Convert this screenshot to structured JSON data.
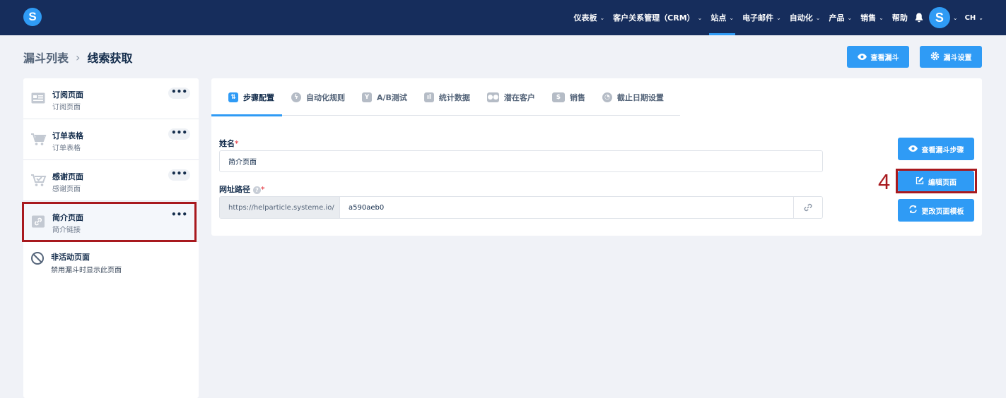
{
  "nav": {
    "items": [
      {
        "label": "仪表板"
      },
      {
        "label": "客户关系管理（CRM）"
      },
      {
        "label": "站点"
      },
      {
        "label": "电子邮件"
      },
      {
        "label": "自动化"
      },
      {
        "label": "产品"
      },
      {
        "label": "销售"
      },
      {
        "label": "帮助"
      }
    ],
    "active_item": "站点",
    "avatar_letter": "S",
    "language": "CH",
    "logo_letter": "S"
  },
  "breadcrumb": {
    "parent": "漏斗列表",
    "current": "线索获取"
  },
  "header_buttons": {
    "view_funnel": "查看漏斗",
    "funnel_settings": "漏斗设置"
  },
  "sidebar": {
    "steps": [
      {
        "title": "订阅页面",
        "subtitle": "订阅页面",
        "icon": "form-icon"
      },
      {
        "title": "订单表格",
        "subtitle": "订单表格",
        "icon": "cart-icon"
      },
      {
        "title": "感谢页面",
        "subtitle": "感谢页面",
        "icon": "cart-check-icon"
      },
      {
        "title": "简介页面",
        "subtitle": "简介链接",
        "icon": "link-icon",
        "selected": true
      }
    ],
    "inactive": {
      "title": "非活动页面",
      "subtitle": "禁用漏斗时显示此页面"
    }
  },
  "tabs": [
    {
      "label": "步骤配置",
      "icon": "sliders-icon",
      "active": true
    },
    {
      "label": "自动化规则",
      "icon": "bolt-icon"
    },
    {
      "label": "A/B测试",
      "icon": "split-icon"
    },
    {
      "label": "统计数据",
      "icon": "bar-chart-icon"
    },
    {
      "label": "潜在客户",
      "icon": "users-icon"
    },
    {
      "label": "销售",
      "icon": "dollar-icon"
    },
    {
      "label": "截止日期设置",
      "icon": "clock-icon"
    }
  ],
  "form": {
    "name_label": "姓名",
    "name_value": "简介页面",
    "url_label": "网址路径",
    "required_mark": "*",
    "url_prefix": "https://helparticle.systeme.io/",
    "url_path": "a590aeb0"
  },
  "action_buttons": {
    "view_step": "查看漏斗步骤",
    "edit_page": "编辑页面",
    "change_template": "更改页面模板"
  },
  "annotation": {
    "step_number": "4",
    "highlight_color": "#a8191e"
  },
  "colors": {
    "accent": "#2f9bf5",
    "navbar": "#162d5c",
    "text": "#142d4c"
  }
}
